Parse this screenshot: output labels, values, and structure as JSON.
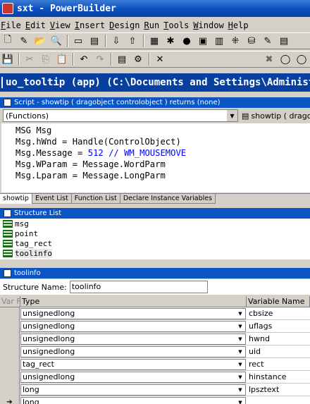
{
  "window": {
    "title": "sxt - PowerBuilder"
  },
  "menu": [
    {
      "label": "File",
      "key": "F"
    },
    {
      "label": "Edit",
      "key": "E"
    },
    {
      "label": "View",
      "key": "V"
    },
    {
      "label": "Insert",
      "key": "I"
    },
    {
      "label": "Design",
      "key": "D"
    },
    {
      "label": "Run",
      "key": "R"
    },
    {
      "label": "Tools",
      "key": "T"
    },
    {
      "label": "Window",
      "key": "W"
    },
    {
      "label": "Help",
      "key": "H"
    }
  ],
  "object_bar": {
    "title": "uo_tooltip (app) (C:\\Documents and Settings\\Administ"
  },
  "script_panel": {
    "title": "Script - showtip ( dragobject controlobject ) returns (none)",
    "object_combo": "(Functions)",
    "event_combo": "showtip ( dragobje",
    "code_lines": [
      {
        "text": "MSG Msg"
      },
      {
        "text": "Msg.hWnd = Handle(ControlObject)"
      },
      {
        "pre": "Msg.Message = ",
        "blue": "512 // WM_MOUSEMOVE"
      },
      {
        "text": "Msg.WParam = Message.WordParm"
      },
      {
        "text": "Msg.Lparam = Message.LongParm"
      }
    ],
    "tabs": [
      "showtip",
      "Event List",
      "Function List",
      "Declare Instance Variables"
    ]
  },
  "structure_list": {
    "title": "Structure List",
    "items": [
      "msg",
      "point",
      "tag_rect",
      "toolinfo"
    ],
    "selected": "toolinfo"
  },
  "structure_editor": {
    "title": "toolinfo",
    "name_label": "Structure Name:",
    "name_value": "toolinfo",
    "columns": [
      "Var F",
      "Type",
      "Variable Name"
    ],
    "rows": [
      {
        "type": "unsignedlong",
        "name": "cbsize"
      },
      {
        "type": "unsignedlong",
        "name": "uflags"
      },
      {
        "type": "unsignedlong",
        "name": "hwnd"
      },
      {
        "type": "unsignedlong",
        "name": "uid"
      },
      {
        "type": "tag_rect",
        "name": "rect"
      },
      {
        "type": "unsignedlong",
        "name": "hinstance"
      },
      {
        "type": "long",
        "name": "lpsztext"
      },
      {
        "type": "long",
        "name": "",
        "current": true
      }
    ]
  },
  "colors": {
    "title_bar": "#0a4fc0",
    "panel_title": "#0a54c4",
    "code_keyword": "#0000ff"
  }
}
